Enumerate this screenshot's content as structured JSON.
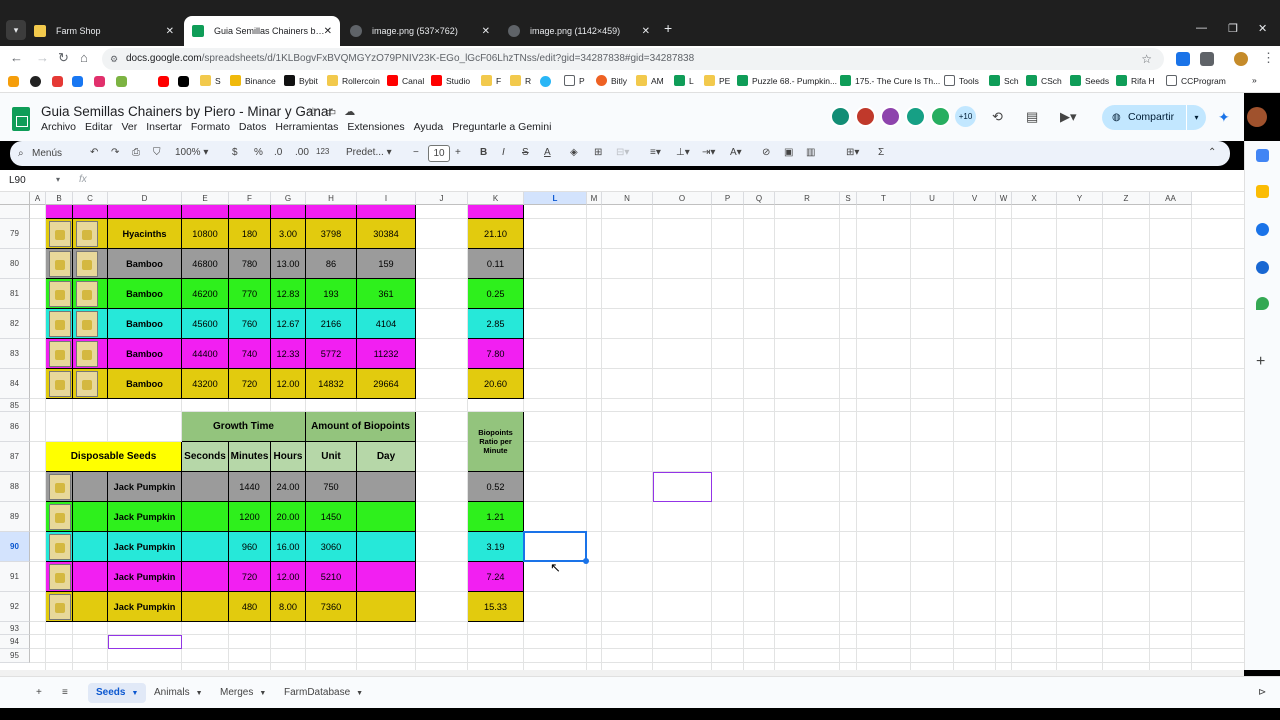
{
  "browser": {
    "tabs": [
      {
        "title": "Farm Shop",
        "color": "#f2c94c"
      },
      {
        "title": "Guia Semillas Chainers by Piero",
        "color": "#0f9d58"
      },
      {
        "title": "image.png (537×762)",
        "color": "#9aa0a6"
      },
      {
        "title": "image.png (1142×459)",
        "color": "#9aa0a6"
      }
    ],
    "url_domain": "docs.google.com",
    "url_path": "/spreadsheets/d/1KLBogvFxBVQMGYzO79PNIV23K-EGo_lGcF06LhzTNss/edit?gid=34287838#gid=34287838",
    "bookmarks": [
      "S",
      "Binance",
      "Bybit",
      "Rollercoin",
      "Canal",
      "Studio",
      "F",
      "R",
      "P",
      "Bitly",
      "AM",
      "L",
      "PE",
      "Puzzle 68.- Pumpkin...",
      "175.- The Cure Is Th...",
      "Tools",
      "Sch",
      "CSch",
      "Seeds",
      "Rifa H",
      "CCProgram"
    ]
  },
  "sheets": {
    "doc_title": "Guia Semillas Chainers by Piero - Minar y Ganar",
    "menu": [
      "Archivo",
      "Editar",
      "Ver",
      "Insertar",
      "Formato",
      "Datos",
      "Herramientas",
      "Extensiones",
      "Ayuda",
      "Preguntarle a Gemini"
    ],
    "collaborators_extra": "+10",
    "share_label": "Compartir",
    "toolbar": {
      "menus": "Menús",
      "zoom": "100%",
      "currency": "$",
      "percent": "%",
      "dec_dec": ".0",
      "dec_inc": ".00",
      "number_fmt": "123",
      "font": "Predet...",
      "font_size": "10",
      "bold": "B",
      "italic": "I",
      "strike": "S",
      "sum": "Σ"
    },
    "name_box": "L90",
    "fx": "fx"
  },
  "columns": [
    "A",
    "B",
    "C",
    "D",
    "E",
    "F",
    "G",
    "H",
    "I",
    "J",
    "K",
    "L",
    "M",
    "N",
    "O",
    "P",
    "Q",
    "R",
    "S",
    "T",
    "U",
    "V",
    "W",
    "X",
    "Y",
    "Z",
    "AA"
  ],
  "rows": [
    "79",
    "80",
    "81",
    "82",
    "83",
    "84",
    "85",
    "86",
    "87",
    "88",
    "89",
    "90",
    "91",
    "92",
    "93",
    "94",
    "95"
  ],
  "selected": {
    "column": "L",
    "row": "90"
  },
  "table1": [
    {
      "name": "Hyacinths",
      "seconds": "10800",
      "minutes": "180",
      "hours": "3.00",
      "unit": "3798",
      "day": "30384",
      "ratio": "21.10",
      "color": "#e2cb0e"
    },
    {
      "name": "Bamboo",
      "seconds": "46800",
      "minutes": "780",
      "hours": "13.00",
      "unit": "86",
      "day": "159",
      "ratio": "0.11",
      "color": "#9b9b9b"
    },
    {
      "name": "Bamboo",
      "seconds": "46200",
      "minutes": "770",
      "hours": "12.83",
      "unit": "193",
      "day": "361",
      "ratio": "0.25",
      "color": "#2ef01c"
    },
    {
      "name": "Bamboo",
      "seconds": "45600",
      "minutes": "760",
      "hours": "12.67",
      "unit": "2166",
      "day": "4104",
      "ratio": "2.85",
      "color": "#26e8d9"
    },
    {
      "name": "Bamboo",
      "seconds": "44400",
      "minutes": "740",
      "hours": "12.33",
      "unit": "5772",
      "day": "11232",
      "ratio": "7.80",
      "color": "#f21ff2"
    },
    {
      "name": "Bamboo",
      "seconds": "43200",
      "minutes": "720",
      "hours": "12.00",
      "unit": "14832",
      "day": "29664",
      "ratio": "20.60",
      "color": "#e2cb0e"
    }
  ],
  "table2_headers": {
    "growth_time": "Growth Time",
    "amount_biopoints": "Amount of Biopoints",
    "disposable_seeds": "Disposable Seeds",
    "seconds": "Seconds",
    "minutes": "Minutes",
    "hours": "Hours",
    "unit": "Unit",
    "day": "Day",
    "ratio": "Biopoints Ratio per Minute"
  },
  "table2": [
    {
      "name": "Jack Pumpkin",
      "seconds": "",
      "minutes": "1440",
      "hours": "24.00",
      "unit": "750",
      "day": "",
      "ratio": "0.52",
      "color": "#9b9b9b"
    },
    {
      "name": "Jack Pumpkin",
      "seconds": "",
      "minutes": "1200",
      "hours": "20.00",
      "unit": "1450",
      "day": "",
      "ratio": "1.21",
      "color": "#2ef01c"
    },
    {
      "name": "Jack Pumpkin",
      "seconds": "",
      "minutes": "960",
      "hours": "16.00",
      "unit": "3060",
      "day": "",
      "ratio": "3.19",
      "color": "#26e8d9"
    },
    {
      "name": "Jack Pumpkin",
      "seconds": "",
      "minutes": "720",
      "hours": "12.00",
      "unit": "5210",
      "day": "",
      "ratio": "7.24",
      "color": "#f21ff2"
    },
    {
      "name": "Jack Pumpkin",
      "seconds": "",
      "minutes": "480",
      "hours": "8.00",
      "unit": "7360",
      "day": "",
      "ratio": "15.33",
      "color": "#e2cb0e"
    }
  ],
  "colors": {
    "header_green": "#93c47d",
    "title_yellow": "#ffff00",
    "subheader_green": "#b6d7a8",
    "selection_blue": "#1a73e8",
    "purple_box": "#9334e6"
  },
  "sheet_tabs": [
    "Seeds",
    "Animals",
    "Merges",
    "FarmDatabase"
  ],
  "active_sheet": "Seeds"
}
